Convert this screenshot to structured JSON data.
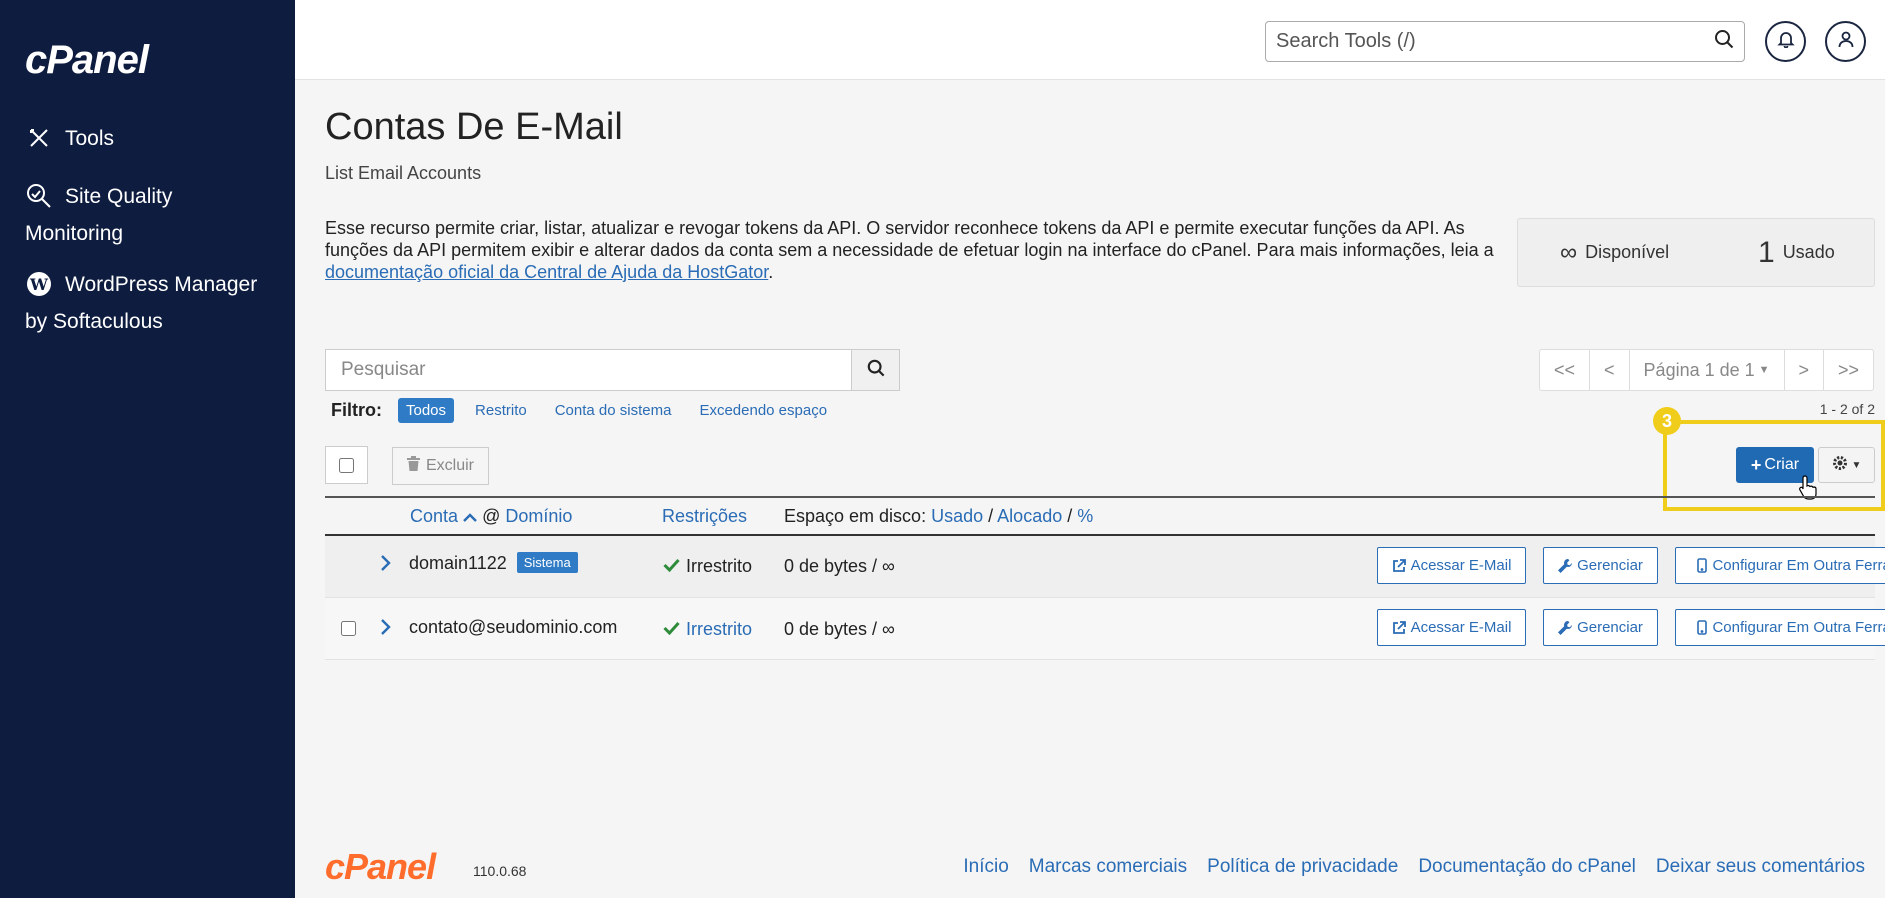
{
  "sidebar": {
    "logo": "cPanel",
    "items": [
      {
        "label": "Tools",
        "icon": "tools-icon"
      },
      {
        "label": "Site Quality",
        "label2": "Monitoring",
        "icon": "site-quality-icon"
      },
      {
        "label": "WordPress Manager",
        "label2": "by Softaculous",
        "icon": "wordpress-icon"
      }
    ]
  },
  "header": {
    "search_placeholder": "Search Tools (/)"
  },
  "main": {
    "title": "Contas De E-Mail",
    "subtitle": "List Email Accounts",
    "description": "Esse recurso permite criar, listar, atualizar e revogar tokens da API. O servidor reconhece tokens da API e permite executar funções da API. As funções da API permitem exibir e alterar dados da conta sem a necessidade de efetuar login na interface do cPanel. Para mais informações, leia a",
    "description_link": "documentação oficial da Central de Ajuda da HostGator",
    "description_end": ".",
    "stats": {
      "available_value": "∞",
      "available_label": "Disponível",
      "used_value": "1",
      "used_label": "Usado"
    },
    "search_placeholder": "Pesquisar",
    "pager": {
      "first": "<<",
      "prev": "<",
      "page": "Página 1 de 1",
      "next": ">",
      "last": ">>"
    },
    "range": "1 - 2 of 2",
    "filter": {
      "label": "Filtro:",
      "options": [
        "Todos",
        "Restrito",
        "Conta do sistema",
        "Excedendo espaço"
      ],
      "selected": "Todos"
    },
    "excluir_label": "Excluir",
    "criar_label": "Criar",
    "annotation_number": "3",
    "table": {
      "headers": {
        "conta": "Conta",
        "at": "@",
        "dominio": "Domínio",
        "restricoes": "Restrições",
        "espaco_prefix": "Espaço em disco:",
        "usado": "Usado",
        "sep": "/",
        "alocado": "Alocado",
        "pct": "%"
      },
      "rows": [
        {
          "account": "domain1122",
          "badge": "Sistema",
          "restriction": "Irrestrito",
          "disk": "0 de bytes / ∞"
        },
        {
          "account": "contato@seudominio.com",
          "restriction": "Irrestrito",
          "disk": "0 de bytes / ∞"
        }
      ],
      "actions": {
        "access": "Acessar E-Mail",
        "manage": "Gerenciar",
        "configure": "Configurar Em Outra Ferramenta"
      }
    }
  },
  "footer": {
    "logo": "cPanel",
    "version": "110.0.68",
    "links": [
      "Início",
      "Marcas comerciais",
      "Política de privacidade",
      "Documentação do cPanel",
      "Deixar seus comentários"
    ]
  },
  "colors": {
    "sidebar_bg": "#0e1c3f",
    "primary": "#1f6ab3",
    "link": "#2a6cb5",
    "highlight": "#f0cd1a",
    "footer_logo": "#ff6c2c",
    "success": "#2e8b3a"
  }
}
